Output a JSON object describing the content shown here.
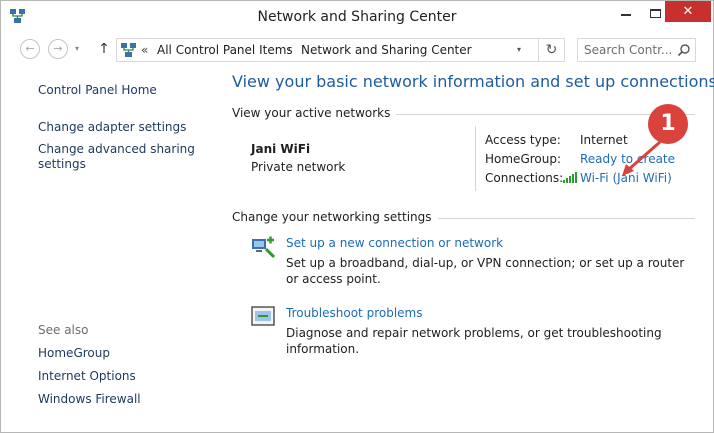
{
  "window": {
    "title": "Network and Sharing Center",
    "close_glyph": "✕"
  },
  "address": {
    "chevron": "«",
    "crumbs": [
      "All Control Panel Items",
      "Network and Sharing Center"
    ],
    "crumb_sep": "›"
  },
  "search": {
    "placeholder": "Search Contr..."
  },
  "nav": {
    "back": "←",
    "forward": "→",
    "up": "↑",
    "refresh": "↻",
    "dropdown": "▾"
  },
  "sidebar": {
    "home": "Control Panel Home",
    "items": [
      "Change adapter settings",
      "Change advanced sharing settings"
    ],
    "see_also_label": "See also",
    "see_also": [
      "HomeGroup",
      "Internet Options",
      "Windows Firewall"
    ]
  },
  "main": {
    "heading": "View your basic network information and set up connections",
    "active_networks_title": "View your active networks",
    "network": {
      "name": "Jani WiFi",
      "type": "Private network"
    },
    "properties": {
      "access_type_label": "Access type:",
      "access_type_value": "Internet",
      "homegroup_label": "HomeGroup:",
      "homegroup_value": "Ready to create",
      "connections_label": "Connections:",
      "connections_value": "Wi-Fi (Jani WiFi)"
    },
    "annotation_number": "1",
    "change_settings_title": "Change your networking settings",
    "tasks": [
      {
        "link": "Set up a new connection or network",
        "desc": "Set up a broadband, dial-up, or VPN connection; or set up a router or access point."
      },
      {
        "link": "Troubleshoot problems",
        "desc": "Diagnose and repair network problems, or get troubleshooting information."
      }
    ]
  },
  "colors": {
    "link": "#1e6bb8",
    "heading": "#1e5b9e",
    "close": "#c7302c",
    "annotation": "#d9433c"
  }
}
